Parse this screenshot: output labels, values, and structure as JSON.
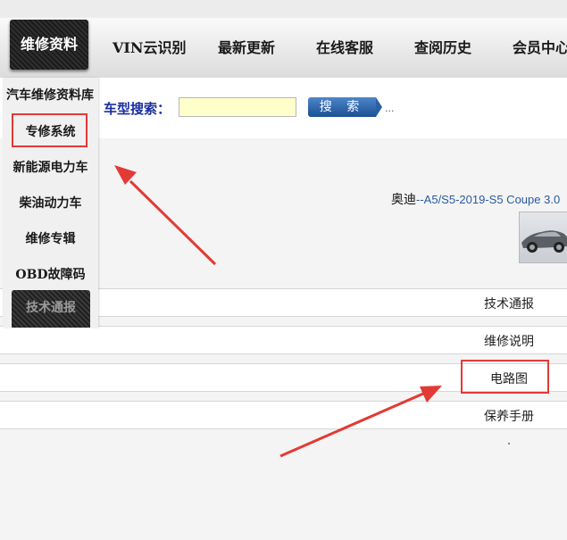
{
  "nav": {
    "active": "维修资料",
    "items": [
      "VIN云识别",
      "最新更新",
      "在线客服",
      "查阅历史",
      "会员中心"
    ]
  },
  "search": {
    "label": "车型搜索：",
    "placeholder": "",
    "button": "搜 索",
    "trailing": "..."
  },
  "sidebar": {
    "header": "汽车维修资料库",
    "items": [
      "专修系统",
      "新能源电力车",
      "柴油动力车",
      "维修专辑",
      "OBD故障码"
    ],
    "dark_item": "技术通报"
  },
  "car": {
    "brand": "奥迪",
    "separator": "--",
    "model": "A5/S5-2019-S5 Coupe 3.0"
  },
  "rows": [
    "技术通报",
    "维修说明",
    "电路图",
    "保养手册"
  ],
  "colors": {
    "annotation": "#e23a36",
    "search_label": "#1a2fa0",
    "model_link": "#2a5aa5",
    "search_input_bg": "#ffffcc"
  }
}
